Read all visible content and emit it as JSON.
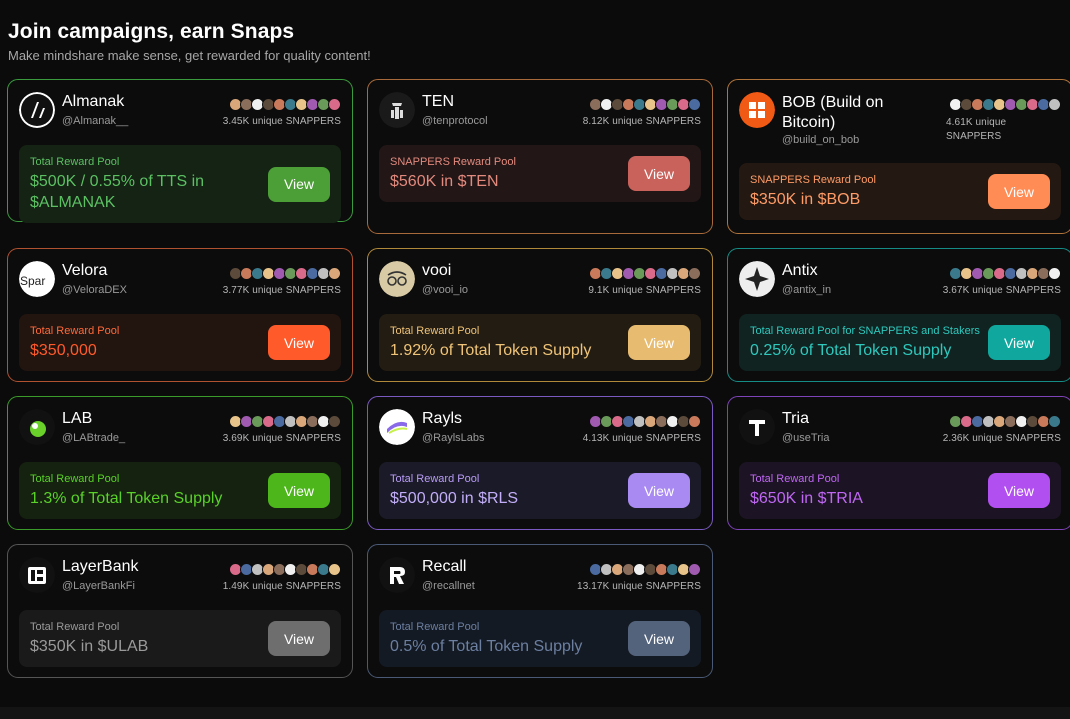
{
  "header": {
    "title": "Join campaigns, earn Snaps",
    "subtitle": "Make mindshare make sense, get rewarded for quality content!"
  },
  "view_label": "View",
  "campaigns": [
    {
      "name": "Almanak",
      "handle": "@Almanak__",
      "snappers": "3.45K unique SNAPPERS",
      "pool_label": "Total Reward Pool",
      "pool_value": "$500K / 0.55% of TTS in $ALMANAK",
      "accent": "#4caf50",
      "logo_icon": "almanak-logo-icon"
    },
    {
      "name": "TEN",
      "handle": "@tenprotocol",
      "snappers": "8.12K unique SNAPPERS",
      "pool_label": "SNAPPERS Reward Pool",
      "pool_value": "$560K in $TEN",
      "accent": "#d97a6f",
      "logo_icon": "ten-logo-icon"
    },
    {
      "name": "BOB (Build on Bitcoin)",
      "handle": "@build_on_bob",
      "snappers": "4.61K unique SNAPPERS",
      "pool_label": "SNAPPERS Reward Pool",
      "pool_value": "$350K in $BOB",
      "accent": "#ff8c55",
      "logo_icon": "bob-logo-icon"
    },
    {
      "name": "Velora",
      "handle": "@VeloraDEX",
      "snappers": "3.77K unique SNAPPERS",
      "pool_label": "Total Reward Pool",
      "pool_value": "$350,000",
      "accent": "#ff5a2a",
      "logo_icon": "velora-logo-icon",
      "logo_alt": "Spar"
    },
    {
      "name": "vooi",
      "handle": "@vooi_io",
      "snappers": "9.1K unique SNAPPERS",
      "pool_label": "Total Reward Pool",
      "pool_value": "1.92% of Total Token Supply",
      "accent": "#e8b86a",
      "logo_icon": "vooi-logo-icon"
    },
    {
      "name": "Antix",
      "handle": "@antix_in",
      "snappers": "3.67K unique SNAPPERS",
      "pool_label": "Total Reward Pool for SNAPPERS and Stakers",
      "pool_value": "0.25% of Total Token Supply",
      "accent": "#17b2a8",
      "logo_icon": "antix-logo-icon"
    },
    {
      "name": "LAB",
      "handle": "@LABtrade_",
      "snappers": "3.69K unique SNAPPERS",
      "pool_label": "Total Reward Pool",
      "pool_value": "1.3% of Total Token Supply",
      "accent": "#4cc21a",
      "logo_icon": "lab-logo-icon"
    },
    {
      "name": "Rayls",
      "handle": "@RaylsLabs",
      "snappers": "4.13K unique SNAPPERS",
      "pool_label": "Total Reward Pool",
      "pool_value": "$500,000 in $RLS",
      "accent": "#a98af2",
      "logo_icon": "rayls-logo-icon"
    },
    {
      "name": "Tria",
      "handle": "@useTria",
      "snappers": "2.36K unique SNAPPERS",
      "pool_label": "Total Reward Pool",
      "pool_value": "$650K in $TRIA",
      "accent": "#b24ff0",
      "logo_icon": "tria-logo-icon"
    },
    {
      "name": "LayerBank",
      "handle": "@LayerBankFi",
      "snappers": "1.49K unique SNAPPERS",
      "pool_label": "Total Reward Pool",
      "pool_value": "$350K in $ULAB",
      "accent": "#8a8a8a",
      "logo_icon": "layerbank-logo-icon"
    },
    {
      "name": "Recall",
      "handle": "@recallnet",
      "snappers": "13.17K unique SNAPPERS",
      "pool_label": "Total Reward Pool",
      "pool_value": "0.5% of Total Token Supply",
      "accent": "#5a6a86",
      "logo_icon": "recall-logo-icon"
    }
  ]
}
